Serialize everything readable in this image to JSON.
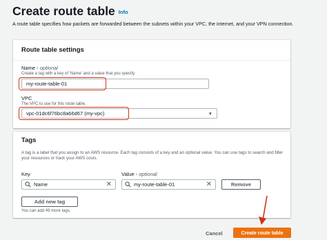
{
  "page": {
    "title": "Create route table",
    "info_label": "Info",
    "description": "A route table specifies how packets are forwarded between the subnets within your VPC, the internet, and your VPN connection."
  },
  "settings": {
    "header": "Route table settings",
    "name_label": "Name",
    "name_optional": "optional",
    "name_separator": " - ",
    "name_description": "Create a tag with a key of 'Name' and a value that you specify.",
    "name_value": "my-route-table-01",
    "vpc_label": "VPC",
    "vpc_description": "The VPC to use for this route table.",
    "vpc_value": "vpc-01dc6f76bc8a66d67 (my-vpc)"
  },
  "tags": {
    "header": "Tags",
    "description": "A tag is a label that you assign to an AWS resource. Each tag consists of a key and an optional value. You can use tags to search and filter your resources or track your AWS costs.",
    "key_col": "Key",
    "value_col": "Value",
    "value_optional": "optional",
    "value_separator": " - ",
    "rows": [
      {
        "key": "Name",
        "value": "my-route-table-01",
        "remove_label": "Remove"
      }
    ],
    "add_label": "Add new tag",
    "remaining": "You can add 49 more tags."
  },
  "footer": {
    "cancel_label": "Cancel",
    "create_label": "Create route table"
  },
  "colors": {
    "accent": "#ec7211",
    "highlight": "#d13212",
    "link": "#0073bb"
  }
}
